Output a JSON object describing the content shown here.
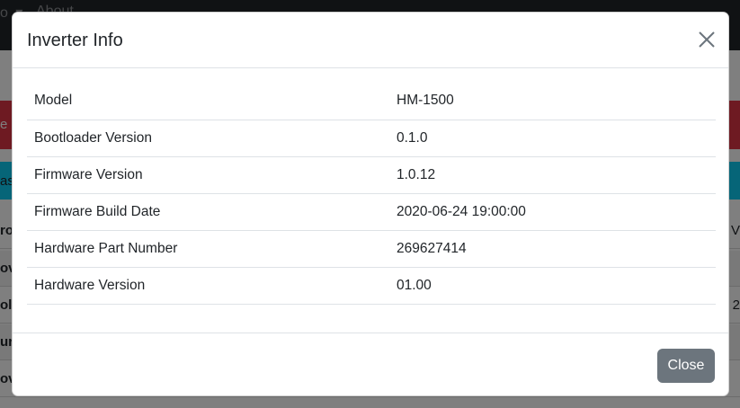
{
  "background": {
    "navbar": {
      "caret": "o ▾",
      "about_label": "About"
    },
    "alert_danger_fragment": "e",
    "alert_info_fragment": "as",
    "table_rows": [
      {
        "left": "ro",
        "right": "V"
      },
      {
        "left": "ov",
        "right": ""
      },
      {
        "left": "ol",
        "right": "2"
      },
      {
        "left": "ur",
        "right": ""
      },
      {
        "left": "ov",
        "right": ""
      }
    ]
  },
  "modal": {
    "title": "Inverter Info",
    "close_icon": "close-icon",
    "rows": [
      {
        "key": "Model",
        "value": "HM-1500"
      },
      {
        "key": "Bootloader Version",
        "value": "0.1.0"
      },
      {
        "key": "Firmware Version",
        "value": "1.0.12"
      },
      {
        "key": "Firmware Build Date",
        "value": "2020-06-24 19:00:00"
      },
      {
        "key": "Hardware Part Number",
        "value": "269627414"
      },
      {
        "key": "Hardware Version",
        "value": "01.00"
      }
    ],
    "footer": {
      "close_button_label": "Close"
    }
  },
  "colors": {
    "navbar": "#212529",
    "alert_danger": "#dc3545",
    "alert_info": "#0dcaf0",
    "secondary_button": "#6c757d",
    "backdrop": "rgba(0,0,0,0.5)"
  }
}
